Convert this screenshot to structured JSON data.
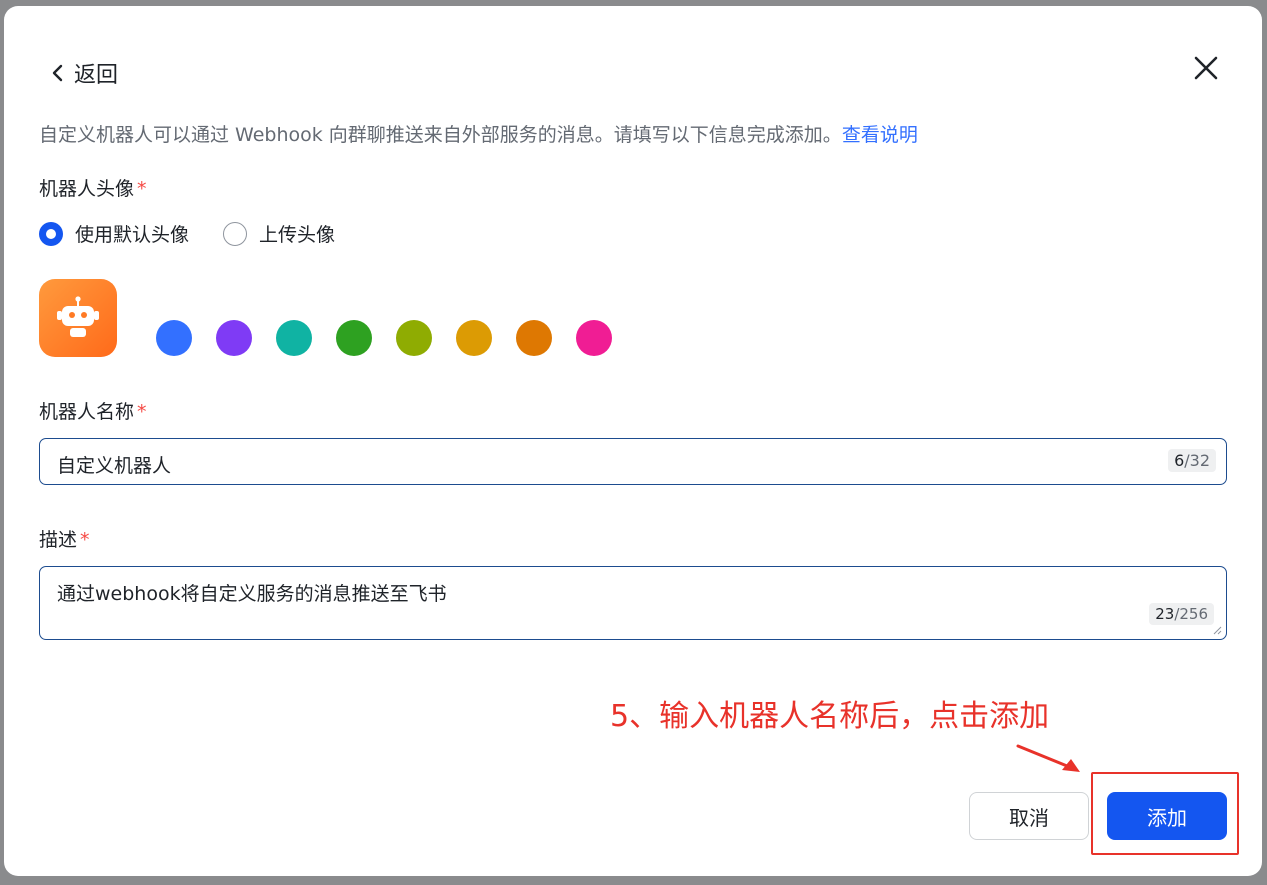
{
  "header": {
    "back_label": "返回"
  },
  "intro": {
    "text": "自定义机器人可以通过 Webhook 向群聊推送来自外部服务的消息。请填写以下信息完成添加。",
    "link": "查看说明"
  },
  "avatar_section": {
    "label": "机器人头像",
    "required_mark": "*",
    "options": [
      {
        "label": "使用默认头像",
        "checked": true
      },
      {
        "label": "上传头像",
        "checked": false
      }
    ],
    "avatar_icon": "robot-icon",
    "colors": [
      "#3370ff",
      "#7f3bf5",
      "#10b3a3",
      "#2ea121",
      "#8fac02",
      "#dc9b04",
      "#de7802",
      "#f01d94"
    ]
  },
  "name_section": {
    "label": "机器人名称",
    "required_mark": "*",
    "value": "自定义机器人",
    "counter_current": "6",
    "counter_max": "/32"
  },
  "desc_section": {
    "label": "描述",
    "required_mark": "*",
    "value": "通过webhook将自定义服务的消息推送至飞书",
    "counter_current": "23",
    "counter_max": "/256"
  },
  "annotation": {
    "text": "5、输入机器人名称后，点击添加"
  },
  "footer": {
    "cancel_label": "取消",
    "add_label": "添加"
  },
  "colors": {
    "primary": "#1456f0",
    "link": "#3370ff",
    "required": "#f54a45",
    "annotation": "#e8322a"
  }
}
